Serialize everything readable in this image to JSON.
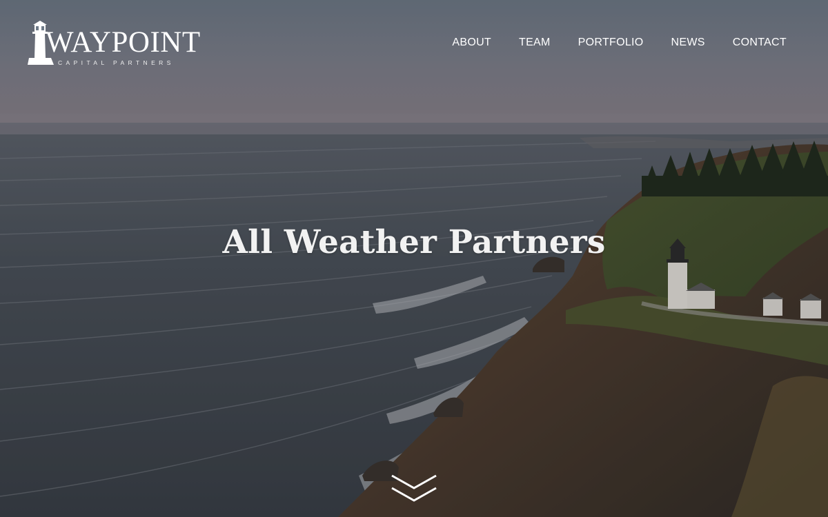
{
  "brand": {
    "name": "WAYPOINT",
    "tagline": "CAPITAL PARTNERS",
    "logo_icon": "lighthouse-icon"
  },
  "nav": {
    "items": [
      {
        "label": "ABOUT"
      },
      {
        "label": "TEAM"
      },
      {
        "label": "PORTFOLIO"
      },
      {
        "label": "NEWS"
      },
      {
        "label": "CONTACT"
      }
    ]
  },
  "hero": {
    "headline": "All Weather Partners",
    "background": "aerial-coastline-lighthouse-photo",
    "scroll_icon": "double-chevron-down-icon"
  },
  "colors": {
    "text": "#ffffff",
    "sea": "#3c434b",
    "cliff": "#5a4332",
    "sky": "#7e7f8a"
  }
}
